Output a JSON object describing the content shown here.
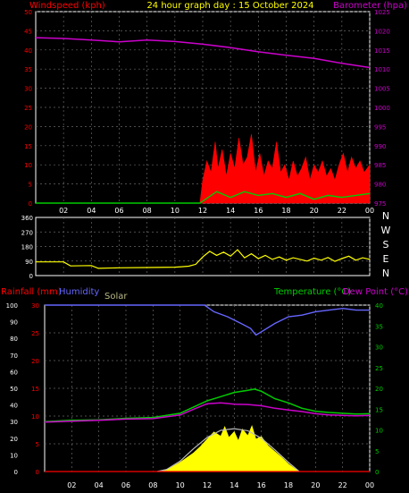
{
  "colors": {
    "wind": "#ff0000",
    "gust_base": "#00cc00",
    "baro": "#cc00cc",
    "wdir": "#ffff00",
    "humidity": "#6666ff",
    "temp": "#00cc00",
    "dew": "#cc00cc",
    "solar_curve": "#bbbbbb",
    "solar_fill": "#ffff00",
    "tick": "#ffff00",
    "grid": "#666666"
  },
  "header": {
    "windspeed_label": "Windspeed (kph)",
    "title": "24 hour graph day : 15 October 2024",
    "baro_label": "Barometer (hpa)"
  },
  "bottom_labels": {
    "rain": "Rainfall (mm)",
    "humidity": "Humidity",
    "solar": "Solar",
    "temp": "Temperature (°C)",
    "dew": "Dew Point (°C)"
  },
  "x_ticks": [
    "02",
    "04",
    "06",
    "08",
    "10",
    "12",
    "14",
    "16",
    "18",
    "20",
    "22",
    "00"
  ],
  "compass": [
    "N",
    "W",
    "S",
    "E",
    "N"
  ],
  "chart_data": [
    {
      "type": "line",
      "title": "24 hour graph day : 15 October 2024",
      "left_axis": {
        "label": "Windspeed (kph)",
        "range": [
          0,
          50
        ],
        "ticks": [
          0,
          5,
          10,
          15,
          20,
          25,
          30,
          35,
          40,
          45,
          50
        ]
      },
      "right_axis": {
        "label": "Barometer (hpa)",
        "range": [
          975,
          1025
        ],
        "ticks": [
          975,
          980,
          985,
          990,
          995,
          1000,
          1005,
          1010,
          1015,
          1020,
          1025
        ]
      },
      "x_range_hours": [
        0,
        24
      ],
      "series": [
        {
          "name": "Barometer (hpa)",
          "axis": "right",
          "points": [
            [
              0,
              1018.2
            ],
            [
              2,
              1018.0
            ],
            [
              4,
              1017.6
            ],
            [
              6,
              1017.1
            ],
            [
              8,
              1017.6
            ],
            [
              10,
              1017.2
            ],
            [
              12,
              1016.5
            ],
            [
              14,
              1015.6
            ],
            [
              16,
              1014.5
            ],
            [
              18,
              1013.6
            ],
            [
              20,
              1012.8
            ],
            [
              22,
              1011.5
            ],
            [
              24,
              1010.4
            ]
          ]
        },
        {
          "name": "Windspeed (kph)",
          "axis": "left",
          "style": "area",
          "points": [
            [
              0,
              0
            ],
            [
              11.8,
              0
            ],
            [
              12,
              6
            ],
            [
              12.3,
              11
            ],
            [
              12.6,
              8
            ],
            [
              12.9,
              16
            ],
            [
              13.1,
              9
            ],
            [
              13.4,
              14
            ],
            [
              13.7,
              7
            ],
            [
              14,
              13
            ],
            [
              14.3,
              9
            ],
            [
              14.6,
              17
            ],
            [
              14.9,
              10
            ],
            [
              15.2,
              12
            ],
            [
              15.5,
              18
            ],
            [
              15.8,
              8
            ],
            [
              16.1,
              13
            ],
            [
              16.4,
              7
            ],
            [
              16.7,
              11
            ],
            [
              17,
              9
            ],
            [
              17.3,
              16
            ],
            [
              17.6,
              8
            ],
            [
              17.9,
              10
            ],
            [
              18.2,
              6
            ],
            [
              18.5,
              11
            ],
            [
              18.8,
              7
            ],
            [
              19.1,
              9
            ],
            [
              19.4,
              12
            ],
            [
              19.7,
              6
            ],
            [
              20,
              10
            ],
            [
              20.3,
              8
            ],
            [
              20.6,
              11
            ],
            [
              20.9,
              7
            ],
            [
              21.2,
              9
            ],
            [
              21.5,
              6
            ],
            [
              21.8,
              10
            ],
            [
              22.1,
              13
            ],
            [
              22.4,
              8
            ],
            [
              22.7,
              12
            ],
            [
              23,
              9
            ],
            [
              23.3,
              11
            ],
            [
              23.6,
              8
            ],
            [
              24,
              10
            ]
          ]
        },
        {
          "name": "Average wind (kph)",
          "axis": "left",
          "points": [
            [
              0,
              0
            ],
            [
              11.8,
              0
            ],
            [
              12,
              0.5
            ],
            [
              13,
              3
            ],
            [
              14,
              1.5
            ],
            [
              15,
              3
            ],
            [
              16,
              2
            ],
            [
              17,
              2.5
            ],
            [
              18,
              1.5
            ],
            [
              19,
              2.5
            ],
            [
              20,
              1
            ],
            [
              21,
              2
            ],
            [
              22,
              1.5
            ],
            [
              23,
              2
            ],
            [
              24,
              2.5
            ]
          ]
        }
      ]
    },
    {
      "type": "line",
      "title": "",
      "left_axis": {
        "range": [
          0,
          360
        ],
        "ticks": [
          0,
          90,
          180,
          270,
          360
        ]
      },
      "right_labels": [
        "N",
        "W",
        "S",
        "E",
        "N"
      ],
      "series": [
        {
          "name": "Wind direction",
          "points": [
            [
              0,
              85
            ],
            [
              2,
              85
            ],
            [
              2.5,
              60
            ],
            [
              4,
              62
            ],
            [
              4.5,
              45
            ],
            [
              6,
              48
            ],
            [
              8,
              50
            ],
            [
              10,
              52
            ],
            [
              10.5,
              55
            ],
            [
              11,
              58
            ],
            [
              11.5,
              70
            ],
            [
              12,
              115
            ],
            [
              12.5,
              150
            ],
            [
              13,
              125
            ],
            [
              13.5,
              145
            ],
            [
              14,
              120
            ],
            [
              14.5,
              160
            ],
            [
              15,
              110
            ],
            [
              15.5,
              135
            ],
            [
              16,
              105
            ],
            [
              16.5,
              125
            ],
            [
              17,
              100
            ],
            [
              17.5,
              115
            ],
            [
              18,
              95
            ],
            [
              18.5,
              110
            ],
            [
              19,
              100
            ],
            [
              19.5,
              90
            ],
            [
              20,
              108
            ],
            [
              20.5,
              95
            ],
            [
              21,
              112
            ],
            [
              21.5,
              88
            ],
            [
              22,
              105
            ],
            [
              22.5,
              120
            ],
            [
              23,
              95
            ],
            [
              23.5,
              110
            ],
            [
              24,
              100
            ]
          ]
        }
      ]
    },
    {
      "type": "line",
      "title": "",
      "axes": {
        "humidity": {
          "label": "Humidity",
          "range": [
            0,
            100
          ],
          "ticks": [
            0,
            10,
            20,
            30,
            40,
            50,
            60,
            70,
            80,
            90,
            100
          ]
        },
        "rainfall": {
          "label": "Rainfall (mm)",
          "range": [
            0,
            30
          ],
          "ticks": [
            0,
            5,
            10,
            15,
            20,
            25,
            30
          ]
        },
        "temperature": {
          "label": "Temperature (°C)",
          "range": [
            0,
            40
          ],
          "ticks": [
            0,
            5,
            10,
            15,
            20,
            25,
            30,
            35,
            40
          ]
        }
      },
      "series": [
        {
          "name": "Humidity",
          "axis": "humidity",
          "points": [
            [
              0,
              100
            ],
            [
              11.8,
              100
            ],
            [
              12.5,
              96
            ],
            [
              13.5,
              93
            ],
            [
              14.5,
              89
            ],
            [
              15.2,
              86
            ],
            [
              15.6,
              82
            ],
            [
              16,
              84
            ],
            [
              17,
              89
            ],
            [
              18,
              93
            ],
            [
              19,
              94
            ],
            [
              20,
              96
            ],
            [
              21,
              97
            ],
            [
              22,
              98
            ],
            [
              23,
              97
            ],
            [
              24,
              97
            ]
          ]
        },
        {
          "name": "Temperature (°C)",
          "axis": "temperature",
          "points": [
            [
              0,
              12
            ],
            [
              2,
              12.3
            ],
            [
              4,
              12.4
            ],
            [
              6,
              12.8
            ],
            [
              8,
              13
            ],
            [
              10,
              14
            ],
            [
              11,
              15.5
            ],
            [
              12,
              17
            ],
            [
              13,
              18
            ],
            [
              14,
              19
            ],
            [
              15,
              19.5
            ],
            [
              15.5,
              19.8
            ],
            [
              16,
              19.3
            ],
            [
              17,
              17.5
            ],
            [
              18,
              16.5
            ],
            [
              19,
              15.2
            ],
            [
              20,
              14.5
            ],
            [
              21,
              14.2
            ],
            [
              22,
              14
            ],
            [
              23,
              13.8
            ],
            [
              24,
              13.9
            ]
          ]
        },
        {
          "name": "Dew Point (°C)",
          "axis": "temperature",
          "points": [
            [
              0,
              11.9
            ],
            [
              2,
              12.1
            ],
            [
              4,
              12.3
            ],
            [
              6,
              12.6
            ],
            [
              8,
              12.7
            ],
            [
              10,
              13.6
            ],
            [
              11,
              15
            ],
            [
              12,
              16.3
            ],
            [
              13,
              16.5
            ],
            [
              14,
              16.2
            ],
            [
              15,
              16.1
            ],
            [
              16,
              15.8
            ],
            [
              17,
              15.2
            ],
            [
              18,
              14.8
            ],
            [
              19,
              14.4
            ],
            [
              20,
              13.9
            ],
            [
              21,
              13.6
            ],
            [
              22,
              13.5
            ],
            [
              23,
              13.4
            ],
            [
              24,
              13.5
            ]
          ]
        },
        {
          "name": "Solar",
          "axis": "temperature",
          "style": "curve",
          "points": [
            [
              8.3,
              0
            ],
            [
              9,
              0.5
            ],
            [
              10,
              2.5
            ],
            [
              11,
              5.5
            ],
            [
              12,
              8.2
            ],
            [
              13,
              9.9
            ],
            [
              14,
              10.3
            ],
            [
              15,
              9.8
            ],
            [
              16,
              8
            ],
            [
              17,
              5.2
            ],
            [
              18,
              2.2
            ],
            [
              18.8,
              0
            ]
          ]
        },
        {
          "name": "Solar",
          "axis": "temperature",
          "style": "area",
          "points": [
            [
              8.3,
              0
            ],
            [
              9,
              0.4
            ],
            [
              10,
              2.2
            ],
            [
              11,
              4.5
            ],
            [
              11.5,
              6
            ],
            [
              12,
              7.8
            ],
            [
              12.5,
              9.5
            ],
            [
              13,
              8.5
            ],
            [
              13.3,
              10.8
            ],
            [
              13.6,
              8.2
            ],
            [
              14,
              9.6
            ],
            [
              14.3,
              7.4
            ],
            [
              14.6,
              10.2
            ],
            [
              15,
              8.6
            ],
            [
              15.3,
              11
            ],
            [
              15.6,
              7.8
            ],
            [
              16,
              8.4
            ],
            [
              16.5,
              6.2
            ],
            [
              17,
              4.8
            ],
            [
              17.5,
              3.4
            ],
            [
              18,
              1.8
            ],
            [
              18.5,
              0.6
            ],
            [
              18.8,
              0
            ]
          ]
        },
        {
          "name": "Rainfall (mm)",
          "axis": "rainfall",
          "points": [
            [
              0,
              0
            ],
            [
              24,
              0
            ]
          ]
        }
      ]
    }
  ]
}
